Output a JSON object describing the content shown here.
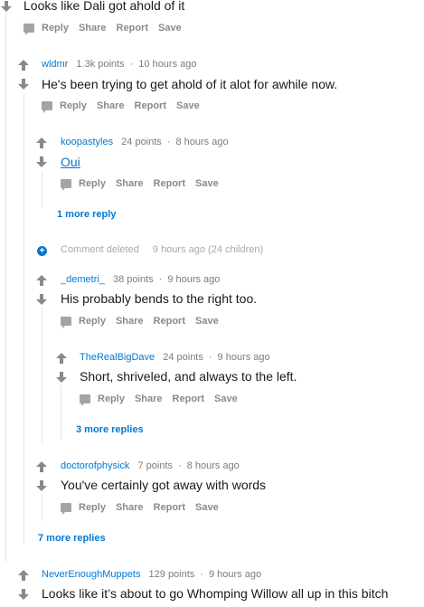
{
  "actions": {
    "reply": "Reply",
    "share": "Share",
    "report": "Report",
    "save": "Save"
  },
  "comments": [
    {
      "id": "c0",
      "body": "Looks like Dali got ahold of it"
    },
    {
      "id": "c1",
      "user": "wldmr",
      "points": "1.3k points",
      "time": "10 hours ago",
      "body": "He's been trying to get ahold of it alot for awhile now."
    },
    {
      "id": "c2",
      "user": "koopastyles",
      "points": "24 points",
      "time": "8 hours ago",
      "body": "Oui",
      "more": "1 more reply"
    },
    {
      "id": "deleted",
      "label": "Comment deleted",
      "time": "9 hours ago (24 children)"
    },
    {
      "id": "c3",
      "user": "_demetri_",
      "points": "38 points",
      "time": "9 hours ago",
      "body": "His probably bends to the right too."
    },
    {
      "id": "c4",
      "user": "TheRealBigDave",
      "points": "24 points",
      "time": "9 hours ago",
      "body": "Short, shriveled, and always to the left.",
      "more": "3 more replies"
    },
    {
      "id": "c5",
      "user": "doctorofphysick",
      "points": "7 points",
      "time": "8 hours ago",
      "body": "You've certainly got away with words"
    },
    {
      "id": "c6",
      "user": "NeverEnoughMuppets",
      "points": "129 points",
      "time": "9 hours ago",
      "body": "Looks like it’s about to go Whomping Willow all up in this bitch"
    }
  ],
  "more_root": "7 more replies",
  "icons": {
    "upvote": "upvote-arrow-icon",
    "downvote": "downvote-arrow-icon",
    "reply": "speech-bubble-icon",
    "expand": "plus-circle-icon"
  }
}
